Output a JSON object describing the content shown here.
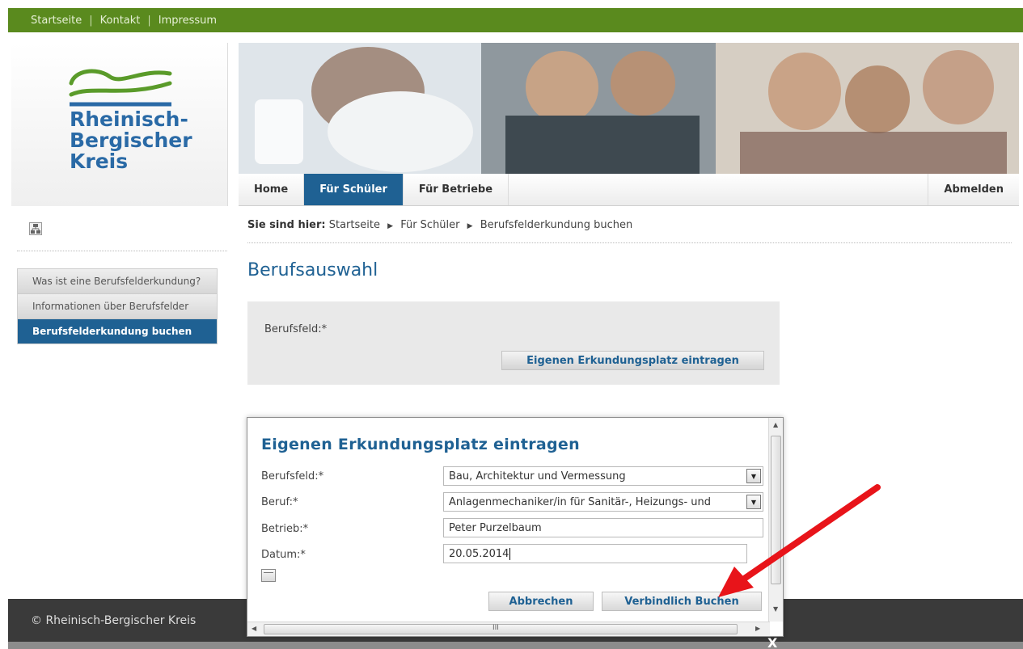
{
  "top_nav": {
    "links": [
      "Startseite",
      "Kontakt",
      "Impressum"
    ]
  },
  "logo": {
    "line1": "Rheinisch-",
    "line2": "Bergischer",
    "line3": "Kreis"
  },
  "main_nav": {
    "tabs": [
      {
        "label": "Home",
        "active": false
      },
      {
        "label": "Für Schüler",
        "active": true
      },
      {
        "label": "Für Betriebe",
        "active": false
      }
    ],
    "logout_label": "Abmelden"
  },
  "breadcrumb": {
    "prefix": "Sie sind hier:",
    "items": [
      "Startseite",
      "Für Schüler",
      "Berufsfelderkundung buchen"
    ]
  },
  "sidebar": {
    "items": [
      {
        "label": "Was ist eine Berufsfelderkundung?",
        "active": false
      },
      {
        "label": "Informationen über Berufsfelder",
        "active": false
      },
      {
        "label": "Berufsfelderkundung buchen",
        "active": true
      }
    ]
  },
  "main": {
    "title": "Berufsauswahl",
    "field_label": "Berufsfeld:*",
    "button_label": "Eigenen Erkundungsplatz eintragen"
  },
  "modal": {
    "title": "Eigenen Erkundungsplatz eintragen",
    "fields": {
      "berufsfeld_label": "Berufsfeld:*",
      "berufsfeld_value": "Bau, Architektur und Vermessung",
      "beruf_label": "Beruf:*",
      "beruf_value": "Anlagenmechaniker/in für Sanitär-, Heizungs- und",
      "betrieb_label": "Betrieb:*",
      "betrieb_value": "Peter Purzelbaum",
      "datum_label": "Datum:*",
      "datum_value": "20.05.2014"
    },
    "cancel_label": "Abbrechen",
    "submit_label": "Verbindlich Buchen",
    "hscroll_grip": "III",
    "close_label": "X"
  },
  "footer": {
    "copyright": "© Rheinisch-Bergischer Kreis"
  },
  "colors": {
    "top_bar": "#5a8a1e",
    "accent_blue": "#1f6193",
    "footer_bg": "#3a3a3a",
    "annotation_arrow": "#e8141a"
  },
  "icons": {
    "sitemap": "sitemap-icon",
    "calendar": "calendar-icon",
    "dropdown": "chevron-down-icon"
  }
}
